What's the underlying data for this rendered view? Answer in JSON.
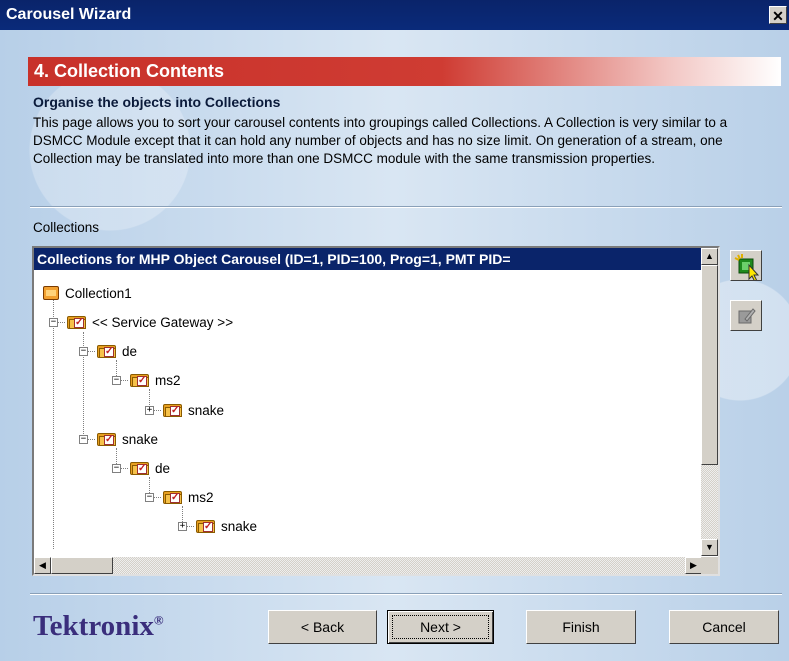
{
  "window": {
    "title": "Carousel Wizard",
    "close_glyph": "✕"
  },
  "page": {
    "heading": "4. Collection Contents",
    "subheading": "Organise the objects into Collections",
    "description": "This page allows you to sort your carousel contents into groupings called Collections. A Collection is very similar to a DSMCC Module except that it can hold any number of objects and has no size limit. On generation of a stream, one Collection may be translated into more than one DSMCC module with the same transmission properties."
  },
  "collections": {
    "label": "Collections",
    "header": "Collections for MHP Object Carousel (ID=1, PID=100, Prog=1, PMT PID=",
    "nodes": [
      {
        "label": "Collection1",
        "icon": "collection-icon",
        "expander": ""
      },
      {
        "label": "<< Service Gateway >>",
        "icon": "folder-checked-icon",
        "expander": "−"
      },
      {
        "label": "de",
        "icon": "folder-checked-icon",
        "expander": "−"
      },
      {
        "label": "ms2",
        "icon": "folder-checked-icon",
        "expander": "−"
      },
      {
        "label": "snake",
        "icon": "folder-checked-icon",
        "expander": "+"
      },
      {
        "label": "snake",
        "icon": "folder-checked-icon",
        "expander": "−"
      },
      {
        "label": "de",
        "icon": "folder-checked-icon",
        "expander": "−"
      },
      {
        "label": "ms2",
        "icon": "folder-checked-icon",
        "expander": "−"
      },
      {
        "label": "snake",
        "icon": "folder-checked-icon",
        "expander": "+"
      }
    ]
  },
  "side_buttons": [
    {
      "icon": "new-collection-icon"
    },
    {
      "icon": "edit-collection-icon"
    }
  ],
  "logo": {
    "text": "Tektronix",
    "mark": "®"
  },
  "buttons": {
    "back": "< Back",
    "next": "Next >",
    "finish": "Finish",
    "cancel": "Cancel"
  },
  "colors": {
    "heading_red": "#c8312a",
    "title_blue": "#0a246a",
    "logo_purple": "#3a2e7c"
  }
}
